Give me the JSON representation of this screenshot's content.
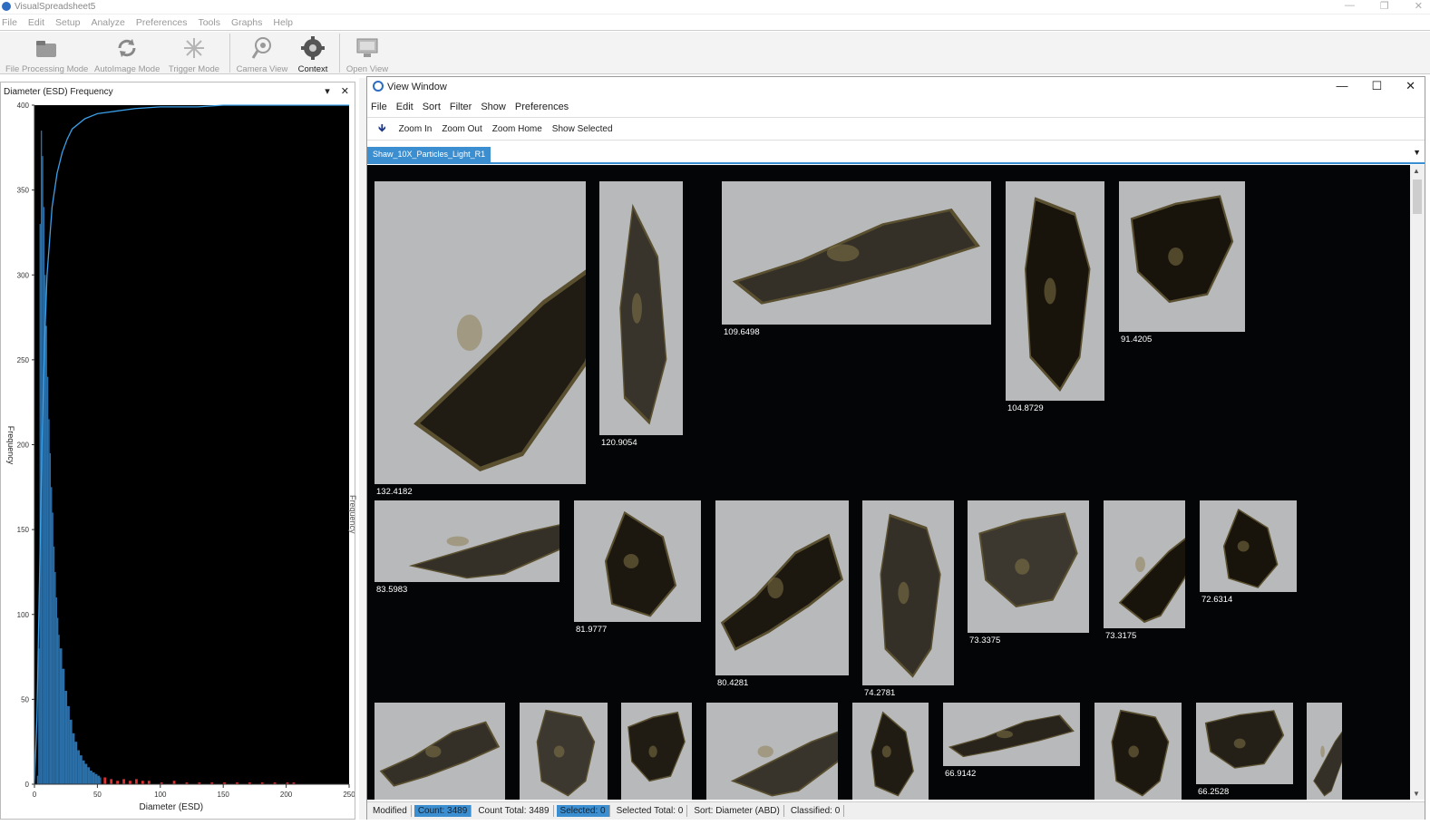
{
  "app": {
    "title": "VisualSpreadsheet5",
    "window_buttons": [
      "—",
      "❐",
      "✕"
    ]
  },
  "menu": [
    "File",
    "Edit",
    "Setup",
    "Analyze",
    "Preferences",
    "Tools",
    "Graphs",
    "Help"
  ],
  "toolbar": [
    {
      "label": "File Processing Mode",
      "icon": "folder-icon"
    },
    {
      "label": "AutoImage Mode",
      "icon": "refresh-icon"
    },
    {
      "label": "Trigger Mode",
      "icon": "burst-icon"
    },
    {
      "label": "Camera View",
      "icon": "eye-icon"
    },
    {
      "label": "Context",
      "icon": "gear-icon"
    },
    {
      "label": "Open View",
      "icon": "monitor-icon"
    }
  ],
  "dock": {
    "title": "Diameter (ESD) Frequency",
    "menu_glyph": "▾",
    "close_glyph": "✕"
  },
  "splitter_label": "Frequency",
  "chart_data": {
    "type": "bar",
    "title": "",
    "xlabel": "Diameter (ESD)",
    "ylabel": "Frequency",
    "xlim": [
      0,
      250
    ],
    "ylim": [
      0,
      400
    ],
    "xticks": [
      0,
      50,
      100,
      150,
      200,
      250
    ],
    "yticks": [
      0,
      50,
      100,
      150,
      200,
      250,
      300,
      350,
      400
    ],
    "bin_width": 1,
    "series": [
      {
        "color": "#2a6fa8",
        "x": [
          2,
          3,
          4,
          5,
          6,
          7,
          8,
          9,
          10,
          11,
          12,
          13,
          14,
          15,
          16,
          17,
          18,
          19,
          20,
          22,
          24,
          26,
          28,
          30,
          32,
          34,
          36,
          38,
          40,
          42,
          44,
          46,
          48,
          50,
          52
        ],
        "values": [
          5,
          80,
          330,
          385,
          370,
          340,
          300,
          270,
          240,
          215,
          195,
          175,
          160,
          140,
          125,
          110,
          98,
          88,
          80,
          68,
          55,
          46,
          38,
          30,
          25,
          20,
          17,
          14,
          12,
          10,
          8,
          7,
          6,
          5,
          4
        ]
      },
      {
        "color": "#e03030",
        "x": [
          55,
          60,
          65,
          70,
          75,
          80,
          85,
          90,
          100,
          110,
          120,
          130,
          140,
          150,
          160,
          170,
          180,
          190,
          200,
          205
        ],
        "values": [
          4,
          3,
          2,
          3,
          2,
          3,
          2,
          2,
          1,
          2,
          1,
          1,
          1,
          1,
          1,
          1,
          1,
          1,
          1,
          1
        ]
      }
    ],
    "cumulative": {
      "color": "#3aa0e8",
      "x": [
        0,
        2,
        4,
        6,
        8,
        10,
        14,
        18,
        22,
        26,
        30,
        40,
        50,
        60,
        80,
        100,
        130,
        150,
        180,
        210,
        250
      ],
      "values": [
        0,
        40,
        120,
        200,
        260,
        300,
        340,
        360,
        372,
        380,
        386,
        392,
        395,
        396,
        398,
        399,
        399,
        400,
        400,
        400,
        400
      ]
    }
  },
  "view_window": {
    "title": "View Window",
    "controls": [
      "—",
      "☐",
      "✕"
    ],
    "menu": [
      "File",
      "Edit",
      "Sort",
      "Filter",
      "Show",
      "Preferences"
    ],
    "tools": [
      "Zoom In",
      "Zoom Out",
      "Zoom Home",
      "Show Selected"
    ],
    "tab": "Shaw_10X_Particles_Light_R1",
    "particles": [
      {
        "value": "132.4182",
        "dark": 0.85
      },
      {
        "value": "120.9054",
        "dark": 0.55
      },
      {
        "value": "109.6498",
        "dark": 0.6
      },
      {
        "value": "104.8729",
        "dark": 0.95
      },
      {
        "value": "91.4205",
        "dark": 0.95
      },
      {
        "value": "83.5983",
        "dark": 0.6
      },
      {
        "value": "81.9777",
        "dark": 0.9
      },
      {
        "value": "80.4281",
        "dark": 0.9
      },
      {
        "value": "74.2781",
        "dark": 0.6
      },
      {
        "value": "73.3375",
        "dark": 0.5
      },
      {
        "value": "73.3175",
        "dark": 0.95
      },
      {
        "value": "72.6314",
        "dark": 0.95
      },
      {
        "value": "",
        "dark": 0.6
      },
      {
        "value": "",
        "dark": 0.5
      },
      {
        "value": "",
        "dark": 0.85
      },
      {
        "value": "",
        "dark": 0.55
      },
      {
        "value": "",
        "dark": 0.85
      },
      {
        "value": "66.9142",
        "dark": 0.75
      },
      {
        "value": "",
        "dark": 0.9
      },
      {
        "value": "66.2528",
        "dark": 0.8
      },
      {
        "value": "",
        "dark": 0.6
      }
    ],
    "status": [
      {
        "text": "Modified",
        "hl": false
      },
      {
        "text": "Count: 3489",
        "hl": true
      },
      {
        "text": "Count Total: 3489",
        "hl": false
      },
      {
        "text": "Selected: 0",
        "hl": true
      },
      {
        "text": "Selected Total: 0",
        "hl": false
      },
      {
        "text": "Sort: Diameter (ABD)",
        "hl": false
      },
      {
        "text": "Classified: 0",
        "hl": false
      }
    ]
  }
}
